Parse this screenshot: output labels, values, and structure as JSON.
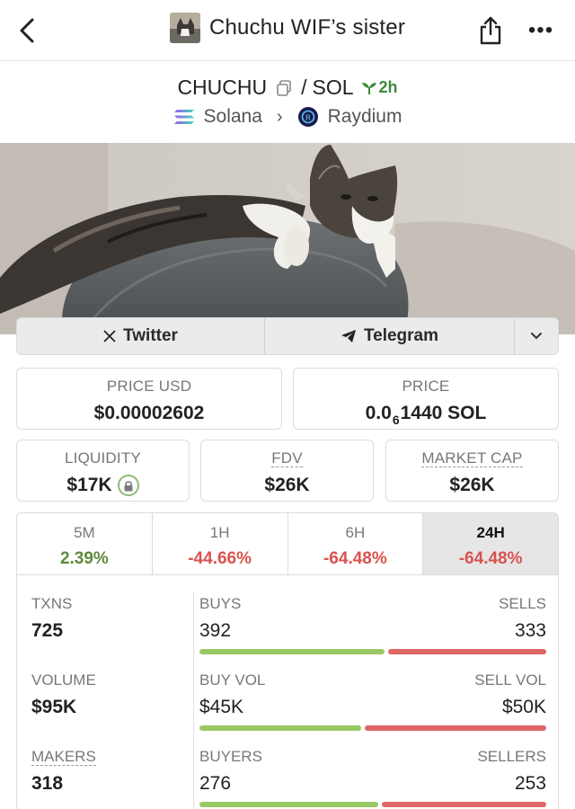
{
  "header": {
    "title": "Chuchu WIF’s sister",
    "back_icon": "chevron-left-icon",
    "share_icon": "share-icon",
    "more_label": "•••"
  },
  "pair": {
    "base": "CHUCHU",
    "separator": "/",
    "quote": "SOL",
    "age": "2h",
    "chain": "Solana",
    "dex": "Raydium"
  },
  "social": {
    "twitter": "Twitter",
    "telegram": "Telegram"
  },
  "stats": {
    "price_usd_label": "PRICE USD",
    "price_usd": "$0.00002602",
    "price_label": "PRICE",
    "price_prefix": "0.0",
    "price_sub": "6",
    "price_suffix": "1440 SOL",
    "liquidity_label": "LIQUIDITY",
    "liquidity": "$17K",
    "fdv_label": "FDV",
    "fdv": "$26K",
    "mcap_label": "MARKET CAP",
    "mcap": "$26K"
  },
  "timeframes": [
    {
      "label": "5M",
      "change": "2.39%",
      "direction": "up"
    },
    {
      "label": "1H",
      "change": "-44.66%",
      "direction": "down"
    },
    {
      "label": "6H",
      "change": "-64.48%",
      "direction": "down"
    },
    {
      "label": "24H",
      "change": "-64.48%",
      "direction": "down",
      "active": true
    }
  ],
  "metrics": {
    "txns_label": "TXNS",
    "txns": "725",
    "volume_label": "VOLUME",
    "volume": "$95K",
    "makers_label": "MAKERS",
    "makers": "318"
  },
  "splits": {
    "buys_label": "BUYS",
    "buys": "392",
    "sells_label": "SELLS",
    "sells": "333",
    "buy_share": 0.54,
    "buy_vol_label": "BUY VOL",
    "buy_vol": "$45K",
    "sell_vol_label": "SELL VOL",
    "sell_vol": "$50K",
    "buy_vol_share": 0.47,
    "buyers_label": "BUYERS",
    "buyers": "276",
    "sellers_label": "SELLERS",
    "sellers": "253",
    "buyers_share": 0.52
  },
  "colors": {
    "positive": "#5d8a3a",
    "negative": "#d9534f",
    "buy_bar": "#9ac865",
    "sell_bar": "#e06666",
    "age_green": "#3f8a3c"
  }
}
